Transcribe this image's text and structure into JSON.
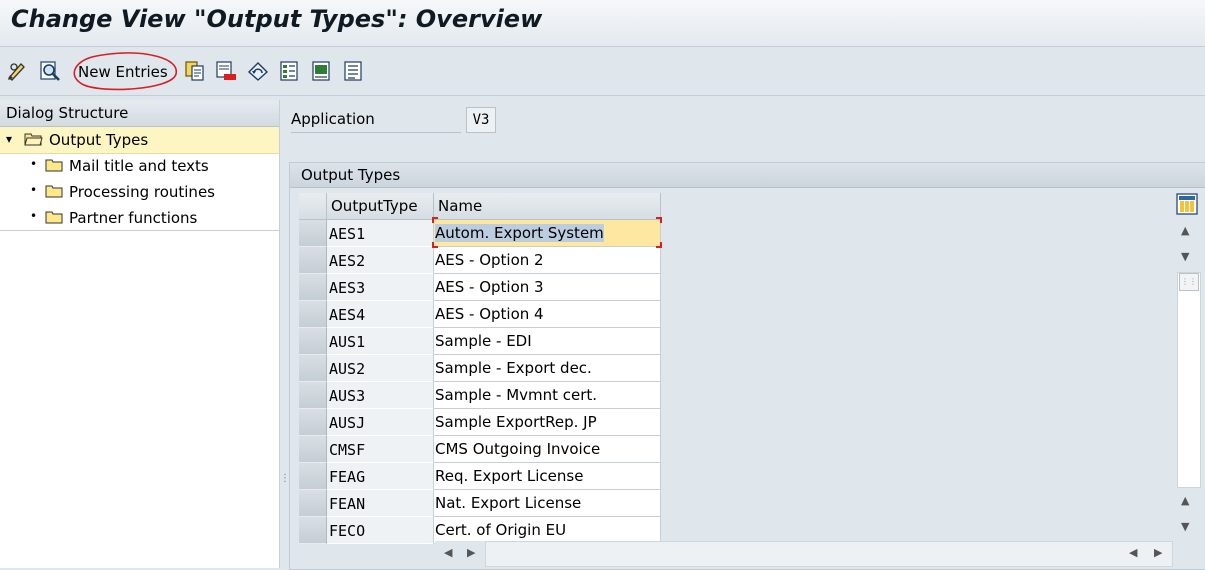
{
  "window": {
    "title": "Change View \"Output Types\": Overview"
  },
  "toolbar": {
    "new_entries_label": "New Entries",
    "icons": [
      "display-change-icon",
      "details-icon",
      "copy-as-icon",
      "delete-icon",
      "undo-change-icon",
      "select-all-icon",
      "select-block-icon",
      "deselect-all-icon"
    ]
  },
  "dialog_structure": {
    "header": "Dialog Structure",
    "items": [
      {
        "label": "Output Types",
        "level": 0,
        "selected": true,
        "expanded": true
      },
      {
        "label": "Mail title and texts",
        "level": 1
      },
      {
        "label": "Processing routines",
        "level": 1
      },
      {
        "label": "Partner functions",
        "level": 1
      }
    ]
  },
  "application": {
    "label": "Application",
    "value": "V3"
  },
  "table": {
    "title": "Output Types",
    "columns": [
      "OutputType",
      "Name"
    ],
    "rows": [
      {
        "code": "AES1",
        "name": "Autom. Export System"
      },
      {
        "code": "AES2",
        "name": "AES - Option 2"
      },
      {
        "code": "AES3",
        "name": "AES - Option 3"
      },
      {
        "code": "AES4",
        "name": "AES - Option 4"
      },
      {
        "code": "AUS1",
        "name": "Sample - EDI"
      },
      {
        "code": "AUS2",
        "name": "Sample - Export dec."
      },
      {
        "code": "AUS3",
        "name": "Sample - Mvmnt cert."
      },
      {
        "code": "AUSJ",
        "name": "Sample ExportRep. JP"
      },
      {
        "code": "CMSF",
        "name": "CMS Outgoing Invoice"
      },
      {
        "code": "FEAG",
        "name": "Req. Export License"
      },
      {
        "code": "FEAN",
        "name": "Nat. Export License"
      },
      {
        "code": "FECO",
        "name": "Cert. of Origin EU"
      }
    ],
    "active_row": 0
  },
  "colors": {
    "accent_red": "#d81f26",
    "selection_yellow": "#fdf6c3",
    "active_cell": "#fde7a1"
  }
}
